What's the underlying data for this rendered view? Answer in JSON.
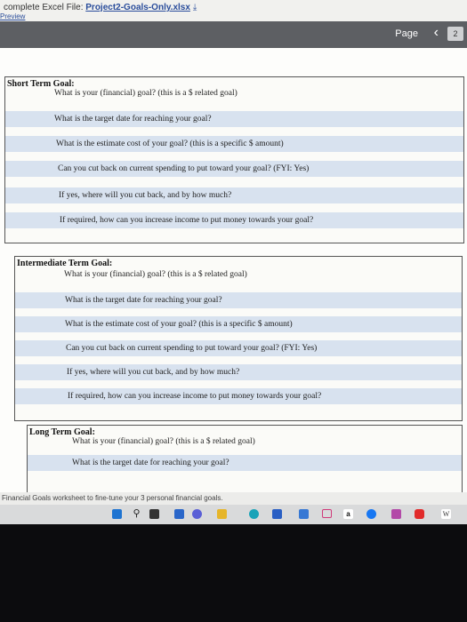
{
  "topbar": {
    "prefix": "complete Excel File: ",
    "filename": "Project2-Goals-Only.xlsx",
    "preview": "Preview"
  },
  "header": {
    "page_label": "Page",
    "page_number": "2"
  },
  "goals": [
    {
      "title": "Short Term Goal:",
      "questions": [
        "What is your (financial) goal? (this is a $ related goal)",
        "What is the target date for reaching your goal?",
        "What is the estimate cost of your goal? (this is a specific $ amount)",
        "Can you cut back on current spending to put toward your goal? (FYI: Yes)",
        "If yes, where will you cut back, and by how much?",
        "If required, how can you increase income to put money towards your goal?"
      ]
    },
    {
      "title": "Intermediate Term Goal:",
      "questions": [
        "What is your (financial) goal? (this is a $ related goal)",
        "What is the target date for reaching your goal?",
        "What is the estimate cost of your goal? (this is a specific $ amount)",
        "Can you cut back on current spending to put toward your goal? (FYI: Yes)",
        "If yes, where will you cut back, and by how much?",
        "If required, how can you increase income to put money towards your goal?"
      ]
    },
    {
      "title": "Long Term Goal:",
      "questions": [
        "What is your (financial) goal? (this is a $ related goal)",
        "What is the target date for reaching your goal?"
      ]
    }
  ],
  "status_text": "Financial Goals worksheet to fine-tune your 3 personal financial goals.",
  "taskbar": {
    "icons": [
      "windows-icon",
      "search-icon",
      "task-view-icon",
      "file-explorer-icon",
      "chat-icon",
      "folder-icon",
      "edge-icon",
      "store-icon",
      "settings-icon",
      "mail-icon",
      "amazon-icon",
      "facebook-icon",
      "app-icon",
      "youtube-icon",
      "word-icon"
    ],
    "amazon_label": "a",
    "word_label": "W"
  }
}
